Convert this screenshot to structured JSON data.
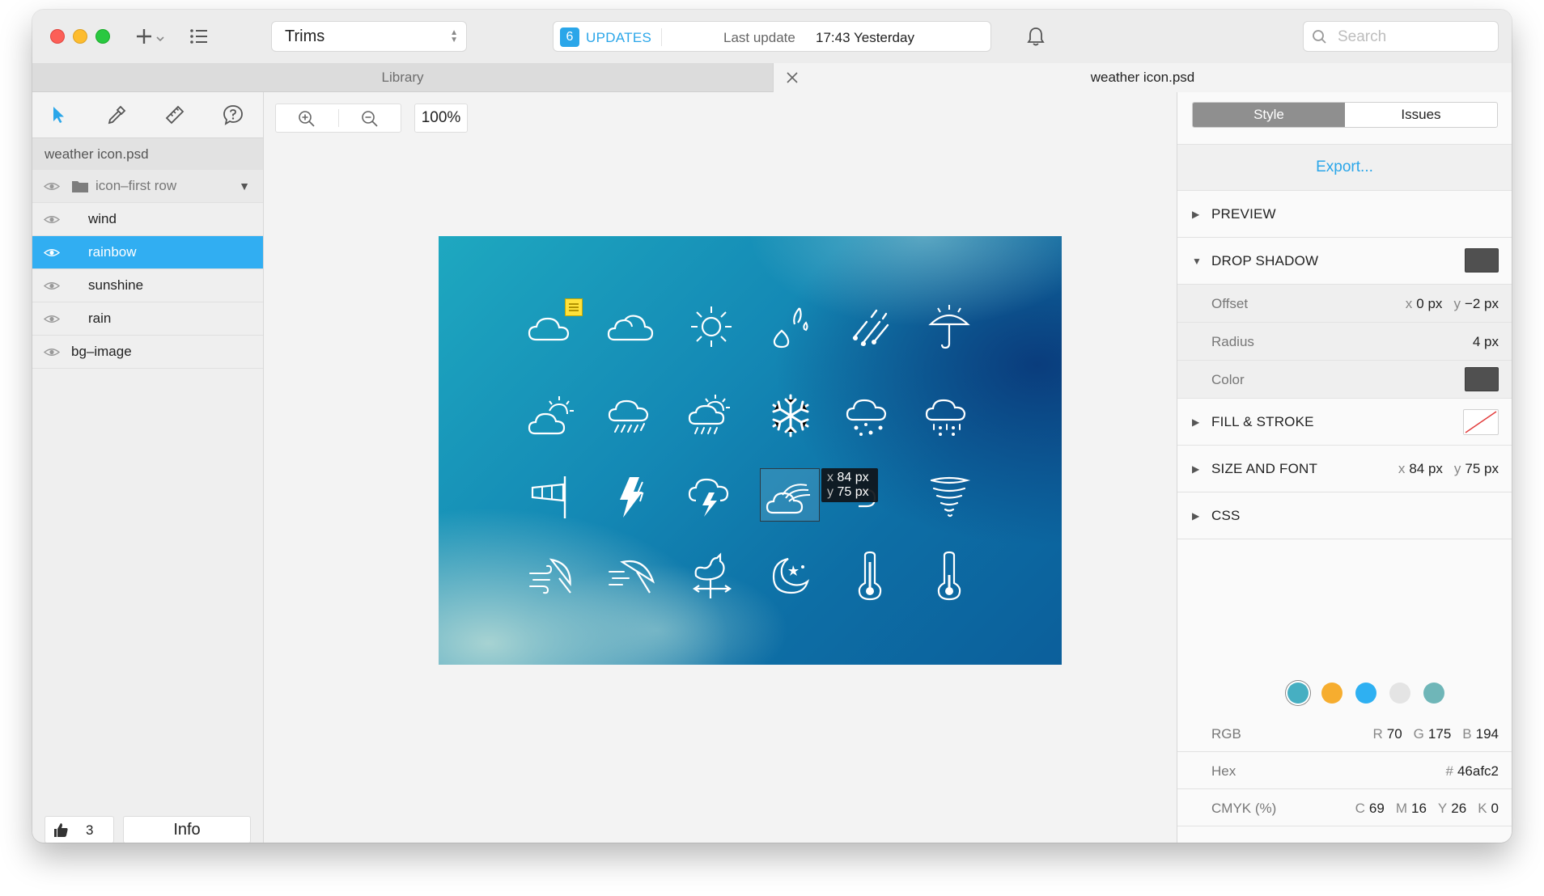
{
  "toolbar": {
    "layout_select": "Trims",
    "update_count": "6",
    "updates_label": "UPDATES",
    "last_update_label": "Last update",
    "last_update_time": "17:43 Yesterday",
    "search_placeholder": "Search"
  },
  "tabs": {
    "library": "Library",
    "document": "weather icon.psd"
  },
  "sidebar": {
    "file_name": "weather icon.psd",
    "group_name": "icon–first row",
    "layers": [
      {
        "label": "wind",
        "selected": false
      },
      {
        "label": "rainbow",
        "selected": true
      },
      {
        "label": "sunshine",
        "selected": false
      },
      {
        "label": "rain",
        "selected": false
      }
    ],
    "bg_layer": "bg–image",
    "likes": "3",
    "info_label": "Info"
  },
  "canvas": {
    "zoom": "100%",
    "tooltip": {
      "x_key": "x",
      "x_value": "84 px",
      "y_key": "y",
      "y_value": "75 px"
    },
    "icons": [
      "cloud-icon",
      "cloud-icon",
      "sun-icon",
      "raindrops-icon",
      "meteor-icon",
      "umbrella-sun-icon",
      "sun-cloud-icon",
      "cloud-rain-icon",
      "sun-cloud-rain-icon",
      "snowflake-icon",
      "cloud-snow-icon",
      "cloud-sleet-icon",
      "windsock-icon",
      "lightning-icon",
      "cloud-lightning-icon",
      "rainbow-cloud-icon",
      "cloud-sun-icon",
      "tornado-icon",
      "wind-umbrella-icon",
      "wind-umbrella-icon",
      "weathervane-icon",
      "moon-star-icon",
      "thermometer-high-icon",
      "thermometer-low-icon"
    ]
  },
  "inspector": {
    "style_tab": "Style",
    "issues_tab": "Issues",
    "export_label": "Export...",
    "preview": "PREVIEW",
    "drop_shadow": "DROP SHADOW",
    "offset_label": "Offset",
    "offset_x_key": "x",
    "offset_x": "0 px",
    "offset_y_key": "y",
    "offset_y": "−2 px",
    "radius_label": "Radius",
    "radius_value": "4 px",
    "color_label": "Color",
    "fill_stroke": "FILL & STROKE",
    "size_font": "SIZE AND FONT",
    "size_x_key": "x",
    "size_x": "84 px",
    "size_y_key": "y",
    "size_y": "75 px",
    "css": "CSS",
    "palette": [
      "#46afc2",
      "#f6ad2f",
      "#2eb0f2",
      "#e4e4e4",
      "#6fb6b8"
    ],
    "shadow_color": "#505050",
    "rgb_label": "RGB",
    "r_key": "R",
    "r": "70",
    "g_key": "G",
    "g": "175",
    "b_key": "B",
    "b": "194",
    "hex_label": "Hex",
    "hex_key": "#",
    "hex": "46afc2",
    "cmyk_label": "CMYK (%)",
    "c_key": "C",
    "c": "69",
    "m_key": "M",
    "m": "16",
    "y_key": "Y",
    "y": "26",
    "k_key": "K",
    "k": "0"
  }
}
